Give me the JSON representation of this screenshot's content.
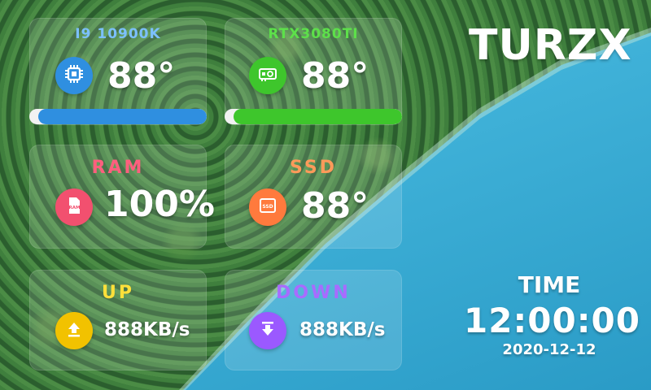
{
  "brand": "TURZX",
  "cards": {
    "cpu": {
      "title": "I9 10900K",
      "value": "88°",
      "icon": "cpu-chip-icon",
      "load": 0.95,
      "color": "#2f8fe0",
      "title_color": "#7cc0ff"
    },
    "gpu": {
      "title": "RTX3080TI",
      "value": "88°",
      "icon": "gpu-card-icon",
      "load": 0.95,
      "color": "#3ec62c",
      "title_color": "#5de04a"
    },
    "ram": {
      "title": "RAM",
      "value": "100%",
      "icon": "ram-icon",
      "icon_text": "RAM",
      "color": "#f2506f",
      "title_color": "#ff5f7e"
    },
    "ssd": {
      "title": "SSD",
      "value": "88°",
      "icon": "ssd-icon",
      "icon_text": "SSD",
      "color": "#ff7a3d",
      "title_color": "#ff9a5a"
    },
    "up": {
      "title": "UP",
      "value": "888KB/s",
      "icon": "upload-icon",
      "color": "#f2c200",
      "title_color": "#ffe03a"
    },
    "down": {
      "title": "DOWN",
      "value": "888KB/s",
      "icon": "download-icon",
      "color": "#9b59ff",
      "title_color": "#a86bff"
    }
  },
  "clock": {
    "label": "TIME",
    "time": "12:00:00",
    "date": "2020-12-12"
  }
}
